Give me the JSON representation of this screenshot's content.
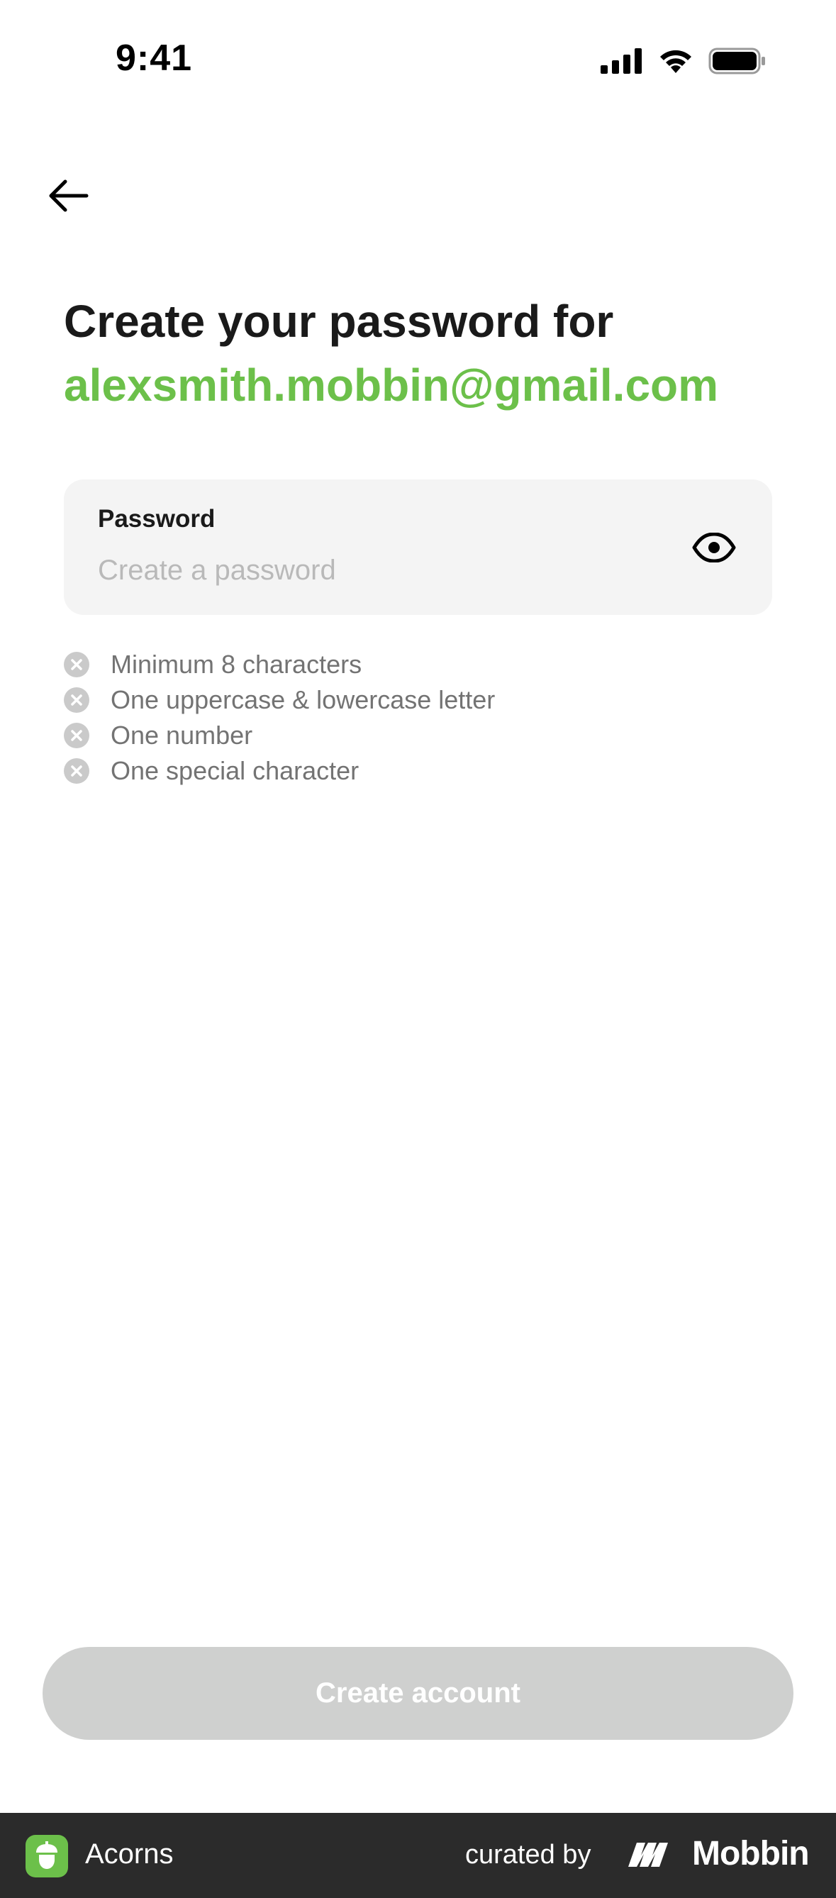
{
  "status_bar": {
    "time": "9:41"
  },
  "header": {
    "back_icon": "arrow-left-icon"
  },
  "title": {
    "line1": "Create your password for",
    "email": "alexsmith.mobbin@gmail.com",
    "email_color": "#6cc04a"
  },
  "password_field": {
    "label": "Password",
    "value": "",
    "placeholder": "Create a password",
    "toggle_icon": "eye-icon"
  },
  "requirements": [
    {
      "text": "Minimum 8 characters",
      "met": false
    },
    {
      "text": "One uppercase & lowercase letter",
      "met": false
    },
    {
      "text": "One number",
      "met": false
    },
    {
      "text": "One special character",
      "met": false
    }
  ],
  "primary_button": {
    "label": "Create account",
    "enabled": false,
    "color": "#cfd0cf"
  },
  "footer": {
    "app_name": "Acorns",
    "app_icon": "acorn-icon",
    "curated_label": "curated by",
    "brand": "Mobbin",
    "brand_icon": "mobbin-logo-icon"
  }
}
